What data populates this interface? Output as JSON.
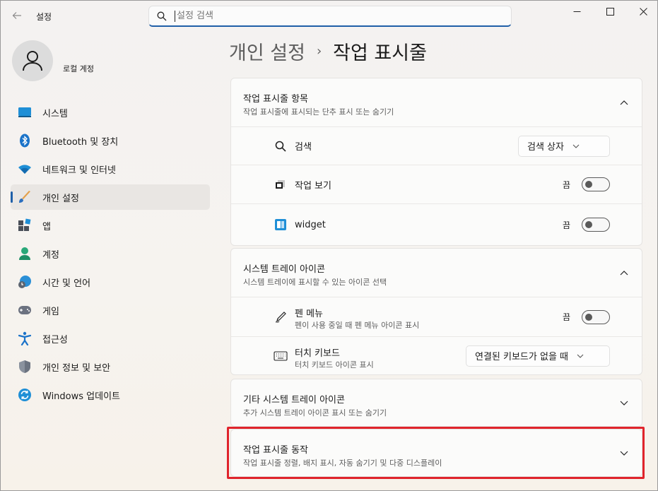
{
  "window": {
    "title": "설정"
  },
  "search": {
    "placeholder": "설정 검색"
  },
  "account": {
    "name": "로컬 계정"
  },
  "sidebar": {
    "items": [
      {
        "label": "시스템",
        "icon": "system-icon"
      },
      {
        "label": "Bluetooth 및 장치",
        "icon": "bluetooth-icon"
      },
      {
        "label": "네트워크 및 인터넷",
        "icon": "wifi-icon"
      },
      {
        "label": "개인 설정",
        "icon": "brush-icon",
        "active": true
      },
      {
        "label": "앱",
        "icon": "apps-icon"
      },
      {
        "label": "계정",
        "icon": "account-icon"
      },
      {
        "label": "시간 및 언어",
        "icon": "time-language-icon"
      },
      {
        "label": "게임",
        "icon": "gamepad-icon"
      },
      {
        "label": "접근성",
        "icon": "accessibility-icon"
      },
      {
        "label": "개인 정보 및 보안",
        "icon": "shield-icon"
      },
      {
        "label": "Windows 업데이트",
        "icon": "update-icon"
      }
    ]
  },
  "breadcrumb": {
    "parent": "개인 설정",
    "separator": "›",
    "current": "작업 표시줄"
  },
  "sections": {
    "taskbar_items": {
      "title": "작업 표시줄 항목",
      "subtitle": "작업 표시줄에 표시되는 단추 표시 또는 숨기기",
      "rows": {
        "search": {
          "label": "검색",
          "value": "검색 상자"
        },
        "task_view": {
          "label": "작업 보기",
          "state": "끔"
        },
        "widget": {
          "label": "widget",
          "state": "끔"
        }
      }
    },
    "system_tray": {
      "title": "시스템 트레이 아이콘",
      "subtitle": "시스템 트레이에 표시할 수 있는 아이콘 선택",
      "rows": {
        "pen_menu": {
          "label": "펜 메뉴",
          "sub": "펜이 사용 중일 때 펜 메뉴 아이콘 표시",
          "state": "끔"
        },
        "touch_keyboard": {
          "label": "터치 키보드",
          "sub": "터치 키보드 아이콘 표시",
          "value": "연결된 키보드가 없을 때"
        }
      }
    },
    "other_tray": {
      "title": "기타 시스템 트레이 아이콘",
      "subtitle": "추가 시스템 트레이 아이콘 표시 또는 숨기기"
    },
    "behaviors": {
      "title": "작업 표시줄 동작",
      "subtitle": "작업 표시줄 정렬, 배지 표시, 자동 숨기기 및 다중 디스플레이"
    }
  },
  "colors": {
    "accent": "#1f5fa8",
    "highlight": "#e0242c"
  }
}
